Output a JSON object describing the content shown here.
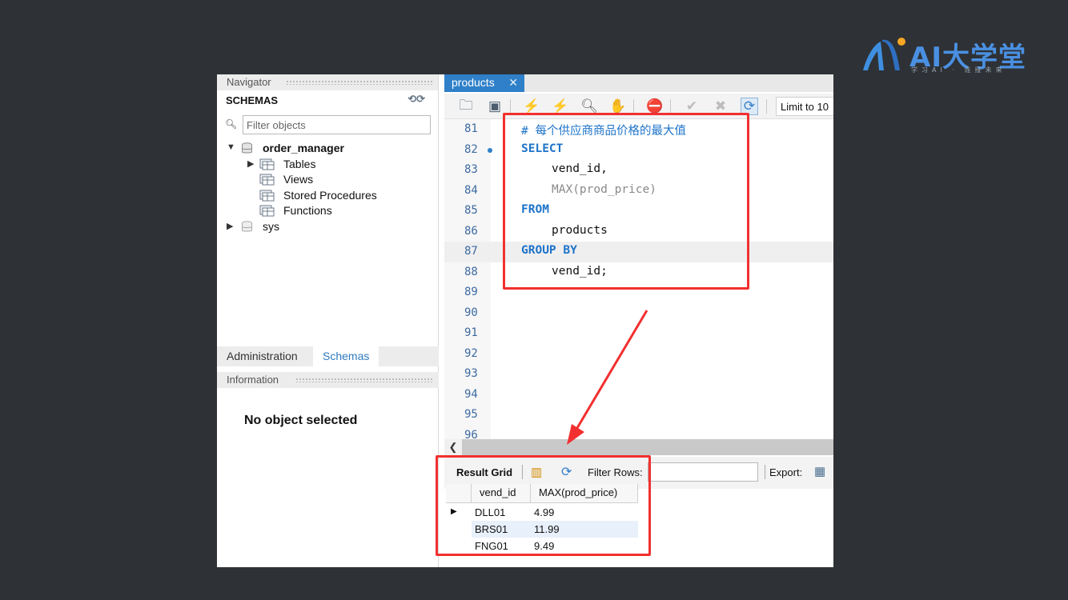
{
  "logo": {
    "text": "AI大学堂",
    "subtitle": "学习AI · 连接未来",
    "color": "#4a90e2"
  },
  "navigator": {
    "title": "Navigator",
    "schemas_title": "SCHEMAS",
    "filter_placeholder": "Filter objects",
    "tree": {
      "db1": "order_manager",
      "tables": "Tables",
      "views": "Views",
      "procedures": "Stored Procedures",
      "functions": "Functions",
      "db2": "sys"
    },
    "tabs": [
      "Administration",
      "Schemas"
    ],
    "information_title": "Information",
    "no_object": "No object selected"
  },
  "editor": {
    "tab_name": "products",
    "limit_label": "Limit to 10",
    "lines": [
      {
        "n": "81",
        "code": "# 每个供应商商品价格的最大值"
      },
      {
        "n": "82",
        "code": "SELECT"
      },
      {
        "n": "83",
        "code": "vend_id,"
      },
      {
        "n": "84",
        "code": "MAX(prod_price)"
      },
      {
        "n": "85",
        "code": "FROM"
      },
      {
        "n": "86",
        "code": "products"
      },
      {
        "n": "87",
        "code": "GROUP BY"
      },
      {
        "n": "88",
        "code": "vend_id;"
      },
      {
        "n": "89",
        "code": ""
      },
      {
        "n": "90",
        "code": ""
      },
      {
        "n": "91",
        "code": ""
      },
      {
        "n": "92",
        "code": ""
      },
      {
        "n": "93",
        "code": ""
      },
      {
        "n": "94",
        "code": ""
      },
      {
        "n": "95",
        "code": ""
      },
      {
        "n": "96",
        "code": ""
      }
    ]
  },
  "result": {
    "grid_label": "Result Grid",
    "filter_label": "Filter Rows:",
    "export_label": "Export:",
    "columns": [
      "vend_id",
      "MAX(prod_price)"
    ],
    "rows": [
      [
        "DLL01",
        "4.99"
      ],
      [
        "BRS01",
        "11.99"
      ],
      [
        "FNG01",
        "9.49"
      ]
    ]
  },
  "colors": {
    "highlight": "#f23030",
    "accent": "#2f80c9",
    "background": "#2e3135"
  }
}
